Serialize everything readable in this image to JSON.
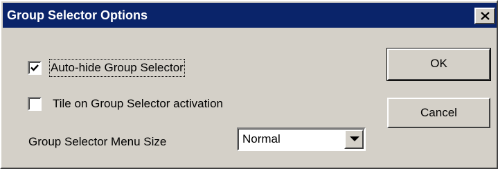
{
  "window": {
    "title": "Group Selector Options",
    "close_icon": "close-icon"
  },
  "options": {
    "auto_hide": {
      "label": "Auto-hide Group Selector",
      "checked": true
    },
    "tile_on_activation": {
      "label": "Tile on Group Selector activation",
      "checked": false
    }
  },
  "menu_size": {
    "label": "Group Selector Menu Size",
    "selected": "Normal"
  },
  "buttons": {
    "ok_label": "OK",
    "cancel_label": "Cancel"
  },
  "colors": {
    "titlebar": "#0a246a",
    "face": "#d4d0c8"
  }
}
